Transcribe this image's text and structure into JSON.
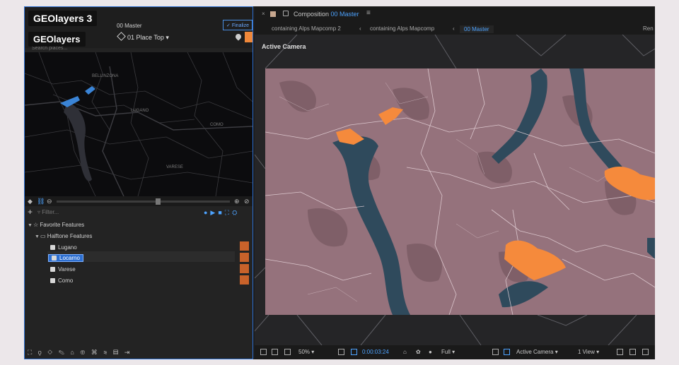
{
  "overlay": {
    "title_badge": "GEOlayers 3",
    "subtitle_badge": "GEOlayers"
  },
  "left_panel": {
    "comp_name": "00 Master",
    "finalize_label": "✓ Finalize",
    "place_selector": "01 Place Top",
    "search_placeholder": "Search places...",
    "map_labels": [
      "BELLINZONA",
      "LUGANO",
      "COMO",
      "VARESE"
    ],
    "filter_placeholder": "Filter...",
    "tree": {
      "favorites_label": "Favorite Features",
      "group_label": "Halftone Features",
      "items": [
        "Lugano",
        "Locarno",
        "Varese",
        "Como"
      ],
      "selected_index": 1
    }
  },
  "right_panel": {
    "tab": {
      "prefix": "Composition",
      "name": "00 Master"
    },
    "breadcrumbs": [
      "containing Alps Mapcomp 2",
      "containing Alps Mapcomp",
      "00 Master"
    ],
    "breadcrumb_tail": "Ren",
    "active_camera_label": "Active Camera",
    "footer": {
      "zoom": "50%",
      "timecode": "0:00:03:24",
      "resolution": "Full",
      "camera": "Active Camera",
      "views": "1 View"
    }
  },
  "colors": {
    "accent": "#2d6fd1",
    "highlight_orange": "#f0883a",
    "land": "#95727c",
    "water": "#2f4a5c",
    "swatch": "#c9622a"
  }
}
